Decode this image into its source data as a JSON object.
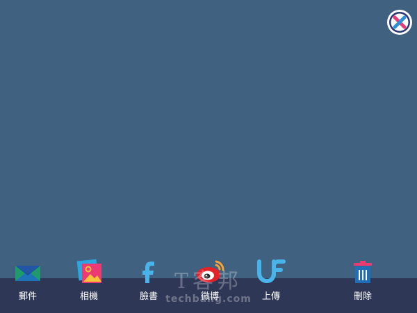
{
  "close": {
    "icon": "close-icon"
  },
  "share_bar": {
    "items": [
      {
        "label": "郵件",
        "icon": "mail-icon"
      },
      {
        "label": "相機",
        "icon": "photos-icon"
      },
      {
        "label": "臉書",
        "icon": "facebook-icon"
      },
      {
        "label": "微博",
        "icon": "weibo-icon"
      },
      {
        "label": "上傳",
        "icon": "upload-icon"
      },
      {
        "label": "刪除",
        "icon": "trash-icon"
      }
    ]
  },
  "watermark": {
    "chinese": "T客邦",
    "url": "techbang.com"
  },
  "colors": {
    "background": "#40617f",
    "bar": "#2f3756",
    "close_ring": "#2a3670",
    "close_x_pink": "#ea3a78",
    "close_x_blue": "#2e8ed8"
  }
}
